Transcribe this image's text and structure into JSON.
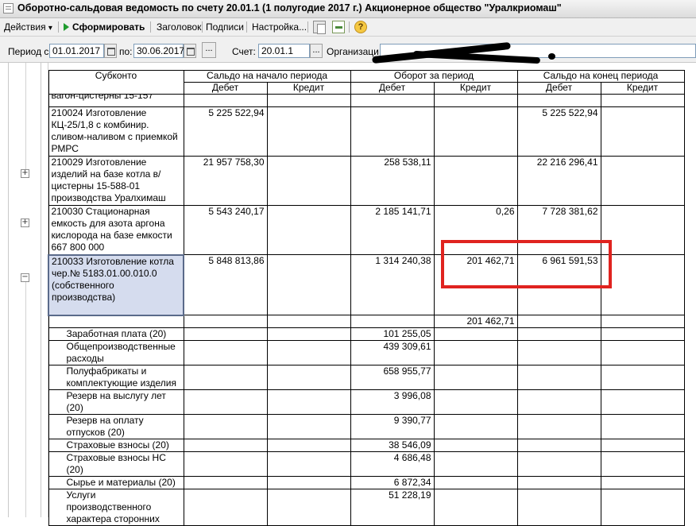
{
  "window": {
    "title": "Оборотно-сальдовая ведомость по счету 20.01.1 (1 полугодие 2017 г.) Акционерное общество \"Уралкриомаш\""
  },
  "toolbar": {
    "actions": "Действия",
    "actions_arrow": "▾",
    "generate": "Сформировать",
    "header": "Заголовок",
    "signatures": "Подписи",
    "settings": "Настройка...",
    "help": "?"
  },
  "params": {
    "period_from_label": "Период с:",
    "period_from": "01.01.2017",
    "period_to_label": "по:",
    "period_to": "30.06.2017",
    "dots": "...",
    "account_label": "Счет:",
    "account": "20.01.1",
    "org_label": "Организаци"
  },
  "table": {
    "headers": {
      "subconto": "Субконто",
      "opening": "Сальдо на начало периода",
      "turnover": "Оборот за период",
      "closing": "Сальдо на конец периода",
      "debit": "Дебет",
      "credit": "Кредит"
    },
    "cut_row": "вагон-цистерны 15-157",
    "rows": [
      {
        "name": "210024 Изготовление КЦ-25/1,8 с комбинир. сливом-наливом с приемкой РМРС",
        "od": "5 225 522,94",
        "oc": "",
        "td": "",
        "tc": "",
        "cd": "5 225 522,94",
        "cc": ""
      },
      {
        "name": "210029 Изготовление изделий на базе котла в/цистерны 15-588-01 производства Уралхимаш",
        "od": "21 957 758,30",
        "oc": "",
        "td": "258 538,11",
        "tc": "",
        "cd": "22 216 296,41",
        "cc": ""
      },
      {
        "name": "210030 Стационарная емкость для азота аргона кислорода на базе емкости 667 800 000",
        "od": "5 543 240,17",
        "oc": "",
        "td": "2 185 141,71",
        "tc": "0,26",
        "cd": "7 728 381,62",
        "cc": ""
      },
      {
        "name": "210033 Изготовление котла чер.№ 5183.01.00.010.0 (собственного производства)",
        "od": "5 848 813,86",
        "oc": "",
        "td": "1 314 240,38",
        "tc": "201 462,71",
        "cd": "6 961 591,53",
        "cc": ""
      },
      {
        "name": "",
        "od": "",
        "oc": "",
        "td": "",
        "tc": "201 462,71",
        "cd": "",
        "cc": ""
      },
      {
        "name": "Заработная плата (20)",
        "od": "",
        "oc": "",
        "td": "101 255,05",
        "tc": "",
        "cd": "",
        "cc": ""
      },
      {
        "name": "Общепроизводственные расходы",
        "od": "",
        "oc": "",
        "td": "439 309,61",
        "tc": "",
        "cd": "",
        "cc": ""
      },
      {
        "name": "Полуфабрикаты и комплектующие изделия",
        "od": "",
        "oc": "",
        "td": "658 955,77",
        "tc": "",
        "cd": "",
        "cc": ""
      },
      {
        "name": "Резерв на выслугу лет (20)",
        "od": "",
        "oc": "",
        "td": "3 996,08",
        "tc": "",
        "cd": "",
        "cc": ""
      },
      {
        "name": "Резерв на оплату отпусков (20)",
        "od": "",
        "oc": "",
        "td": "9 390,77",
        "tc": "",
        "cd": "",
        "cc": ""
      },
      {
        "name": "Страховые взносы (20)",
        "od": "",
        "oc": "",
        "td": "38 546,09",
        "tc": "",
        "cd": "",
        "cc": ""
      },
      {
        "name": "Страховые взносы НС (20)",
        "od": "",
        "oc": "",
        "td": "4 686,48",
        "tc": "",
        "cd": "",
        "cc": ""
      },
      {
        "name": "Сырье и материалы (20)",
        "od": "",
        "oc": "",
        "td": "6 872,34",
        "tc": "",
        "cd": "",
        "cc": ""
      },
      {
        "name": "Услуги производственного характера сторонних",
        "od": "",
        "oc": "",
        "td": "51 228,19",
        "tc": "",
        "cd": "",
        "cc": ""
      }
    ]
  },
  "tree": {
    "expand": "+",
    "collapse": "−"
  },
  "colors": {
    "highlight": "#e0231f",
    "selected_row": "#d5dcee"
  }
}
